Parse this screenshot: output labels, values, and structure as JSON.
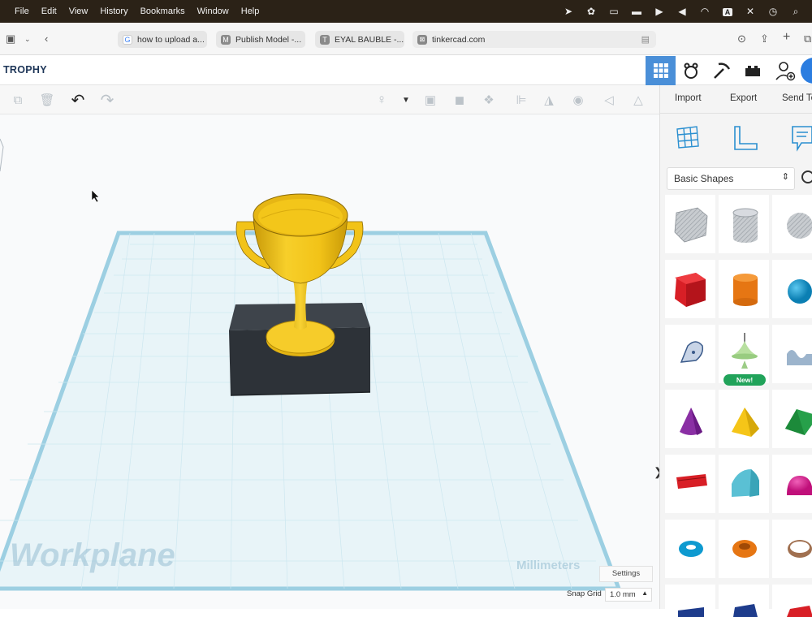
{
  "menubar": {
    "apple": "",
    "items": [
      "File",
      "Edit",
      "View",
      "History",
      "Bookmarks",
      "Window",
      "Help"
    ],
    "status_letter": "A"
  },
  "browser": {
    "tabs": [
      {
        "label": "how to upload a...",
        "favicon": "G"
      },
      {
        "label": "Publish Model -...",
        "favicon": "M"
      },
      {
        "label": "EYAL BAUBLE -...",
        "favicon": "T"
      }
    ],
    "address": "tinkercad.com",
    "address_favicon": "⊠"
  },
  "tinkercad": {
    "title": "TROPHY"
  },
  "panel": {
    "import_label": "Import",
    "export_label": "Export",
    "send_label": "Send To",
    "category": "Basic Shapes",
    "new_badge": "New!"
  },
  "viewport": {
    "workplane_label": "Workplane",
    "units_label": "Millimeters",
    "settings_label": "Settings",
    "snap_label": "Snap Grid",
    "snap_value": "1.0 mm"
  },
  "colors": {
    "accent": "#4a8fd8",
    "trophy_gold": "#f2c318",
    "base_dark": "#2d3238",
    "grid": "#cde7f0"
  }
}
